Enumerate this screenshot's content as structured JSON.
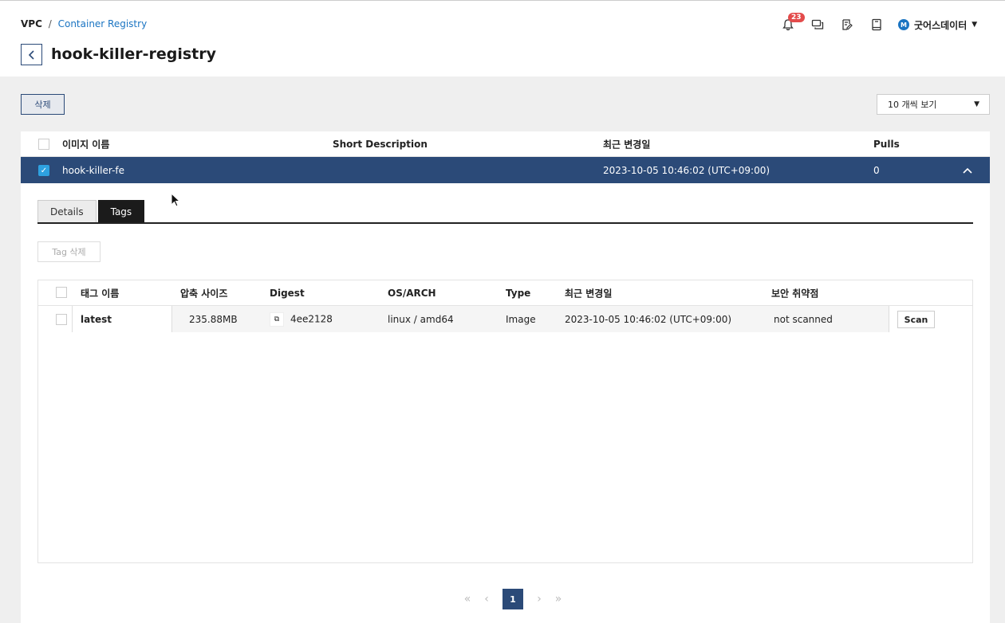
{
  "header": {
    "breadcrumb_root": "VPC",
    "breadcrumb_sep": "/",
    "breadcrumb_current": "Container Registry",
    "title": "hook-killer-registry",
    "notification_count": "23",
    "user_initial": "M",
    "user_name": "굿어스데이터"
  },
  "toolbar": {
    "delete_label": "삭제",
    "per_page": "10 개씩 보기"
  },
  "table": {
    "columns": [
      "이미지 이름",
      "Short Description",
      "최근 변경일",
      "Pulls"
    ],
    "row": {
      "name": "hook-killer-fe",
      "description": "",
      "updated": "2023-10-05 10:46:02 (UTC+09:00)",
      "pulls": "0"
    }
  },
  "detail": {
    "tabs": [
      "Details",
      "Tags"
    ],
    "active_tab": "Tags",
    "tag_delete_label": "Tag 삭제",
    "columns": [
      "태그 이름",
      "압축 사이즈",
      "Digest",
      "OS/ARCH",
      "Type",
      "최근 변경일",
      "보안 취약점"
    ],
    "rows": [
      {
        "tag": "latest",
        "size": "235.88MB",
        "digest": "4ee2128",
        "os_arch": "linux / amd64",
        "type": "Image",
        "updated": "2023-10-05 10:46:02 (UTC+09:00)",
        "vuln": "not scanned",
        "action": "Scan"
      }
    ]
  },
  "pagination": {
    "current": "1"
  },
  "colors": {
    "primary": "#2b4a78",
    "accent": "#1a74c2",
    "badge": "#e34b4b"
  }
}
